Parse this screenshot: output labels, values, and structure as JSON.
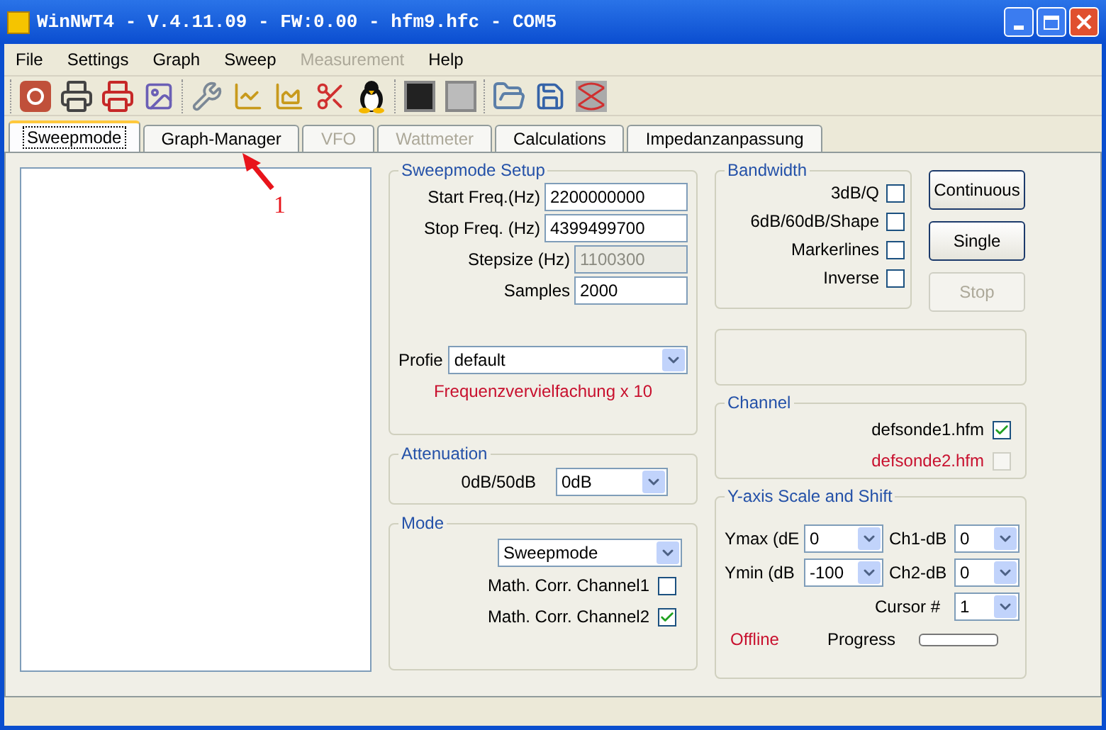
{
  "window": {
    "title": "WinNWT4 - V.4.11.09 - FW:0.00 - hfm9.hfc - COM5"
  },
  "menu": [
    {
      "label": "File",
      "disabled": false
    },
    {
      "label": "Settings",
      "disabled": false
    },
    {
      "label": "Graph",
      "disabled": false
    },
    {
      "label": "Sweep",
      "disabled": false
    },
    {
      "label": "Measurement",
      "disabled": true
    },
    {
      "label": "Help",
      "disabled": false
    }
  ],
  "tabs": [
    {
      "label": "Sweepmode",
      "selected": true,
      "disabled": false
    },
    {
      "label": "Graph-Manager",
      "selected": false,
      "disabled": false
    },
    {
      "label": "VFO",
      "selected": false,
      "disabled": true
    },
    {
      "label": "Wattmeter",
      "selected": false,
      "disabled": true
    },
    {
      "label": "Calculations",
      "selected": false,
      "disabled": false
    },
    {
      "label": "Impedanzanpassung",
      "selected": false,
      "disabled": false
    }
  ],
  "sweepmode_setup": {
    "title": "Sweepmode Setup",
    "fields": [
      {
        "label": "Start Freq.(Hz)",
        "value": "2200000000",
        "disabled": false,
        "wide": true
      },
      {
        "label": "Stop Freq. (Hz)",
        "value": "4399499700",
        "disabled": false,
        "wide": true
      },
      {
        "label": "Stepsize (Hz)",
        "value": "1100300",
        "disabled": true,
        "wide": false
      },
      {
        "label": "Samples",
        "value": "2000",
        "disabled": false,
        "wide": false
      }
    ],
    "profile": {
      "label": "Profie",
      "value": "default"
    },
    "note": "Frequenzvervielfachung x 10"
  },
  "attenuation": {
    "title": "Attenuation",
    "label": "0dB/50dB",
    "value": "0dB"
  },
  "mode": {
    "title": "Mode",
    "value": "Sweepmode",
    "checks": [
      {
        "label": "Math. Corr. Channel1",
        "checked": false
      },
      {
        "label": "Math. Corr. Channel2",
        "checked": true
      }
    ]
  },
  "bandwidth": {
    "title": "Bandwidth",
    "checks": [
      {
        "label": "3dB/Q",
        "checked": false
      },
      {
        "label": "6dB/60dB/Shape",
        "checked": false
      },
      {
        "label": "Markerlines",
        "checked": false
      },
      {
        "label": "Inverse",
        "checked": false
      }
    ]
  },
  "buttons": [
    {
      "label": "Continuous",
      "disabled": false
    },
    {
      "label": "Single",
      "disabled": false
    },
    {
      "label": "Stop",
      "disabled": true
    }
  ],
  "channel": {
    "title": "Channel",
    "items": [
      {
        "label": "defsonde1.hfm",
        "checked": true,
        "available": true
      },
      {
        "label": "defsonde2.hfm",
        "checked": false,
        "available": false
      }
    ]
  },
  "y_axis": {
    "title": "Y-axis Scale and Shift",
    "selects": [
      {
        "label": "Ymax (dE",
        "value": "0"
      },
      {
        "label": "Ch1-dB",
        "value": "0"
      },
      {
        "label": "Ymin (dB",
        "value": "-100"
      },
      {
        "label": "Ch2-dB",
        "value": "0"
      }
    ],
    "cursor": {
      "label": "Cursor #",
      "value": "1"
    },
    "status": "Offline",
    "progress": {
      "label": "Progress",
      "level": 0
    }
  },
  "annotation": {
    "label": "1"
  }
}
